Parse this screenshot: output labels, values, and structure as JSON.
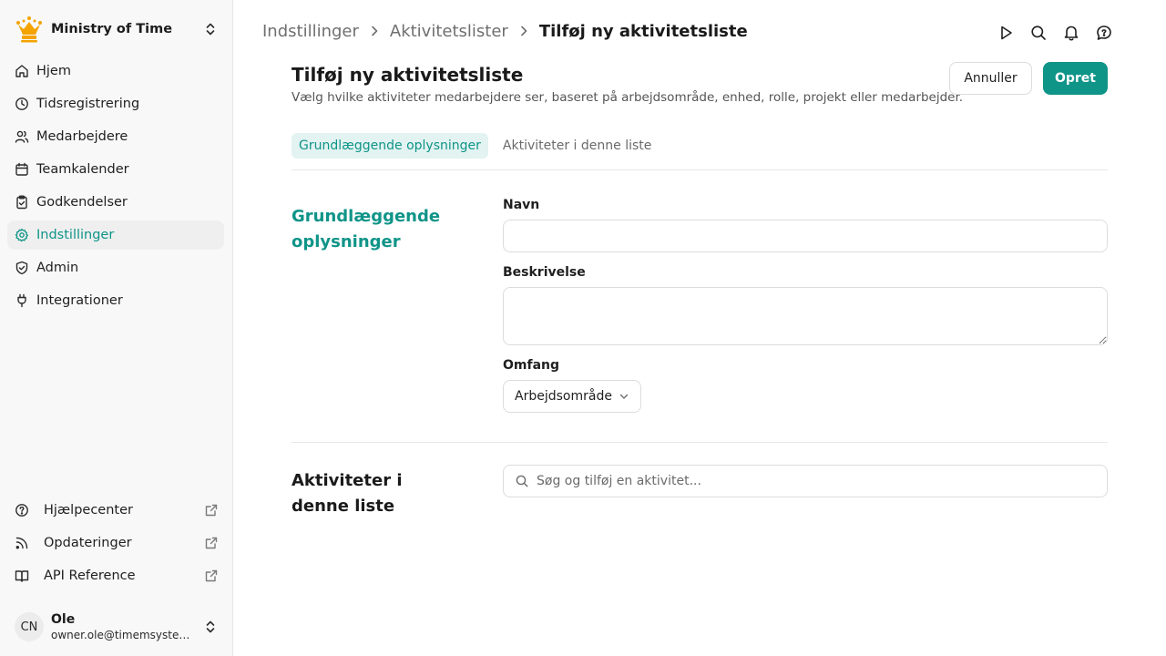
{
  "colors": {
    "accent": "#0f9488",
    "crown": "#f4a300"
  },
  "org": {
    "name": "Ministry of Time",
    "logo_icon": "crown-icon"
  },
  "nav": [
    {
      "label": "Hjem",
      "icon": "home-icon"
    },
    {
      "label": "Tidsregistrering",
      "icon": "clock-icon"
    },
    {
      "label": "Medarbejdere",
      "icon": "users-icon"
    },
    {
      "label": "Teamkalender",
      "icon": "calendar-icon"
    },
    {
      "label": "Godkendelser",
      "icon": "clipboard-check-icon"
    },
    {
      "label": "Indstillinger",
      "icon": "gear-icon",
      "active": true
    },
    {
      "label": "Admin",
      "icon": "shield-check-icon"
    },
    {
      "label": "Integrationer",
      "icon": "plug-icon"
    }
  ],
  "footer_links": [
    {
      "label": "Hjælpecenter",
      "icon": "help-circle-icon"
    },
    {
      "label": "Opdateringer",
      "icon": "rss-icon"
    },
    {
      "label": "API Reference",
      "icon": "book-icon"
    }
  ],
  "user": {
    "initials": "CN",
    "name": "Ole",
    "email": "owner.ole@timemsystem.dk"
  },
  "breadcrumb": [
    "Indstillinger",
    "Aktivitetslister",
    "Tilføj ny aktivitetsliste"
  ],
  "top_icons": [
    "play-icon",
    "search-icon",
    "bell-icon",
    "help-chat-icon"
  ],
  "page": {
    "title": "Tilføj ny aktivitetsliste",
    "subtitle": "Vælg hvilke aktiviteter medarbejdere ser, baseret på arbejdsområde, enhed, rolle, projekt eller medarbejder.",
    "cancel_label": "Annuller",
    "create_label": "Opret"
  },
  "tabs": [
    {
      "label": "Grundlæggende oplysninger",
      "active": true
    },
    {
      "label": "Aktiviteter i denne liste",
      "active": false
    }
  ],
  "basic_section": {
    "title": "Grundlæggende oplysninger",
    "name_label": "Navn",
    "name_value": "",
    "description_label": "Beskrivelse",
    "description_value": "",
    "scope_label": "Omfang",
    "scope_value": "Arbejdsområde"
  },
  "activities_section": {
    "title": "Aktiviteter i denne liste",
    "search_placeholder": "Søg og tilføj en aktivitet..."
  }
}
